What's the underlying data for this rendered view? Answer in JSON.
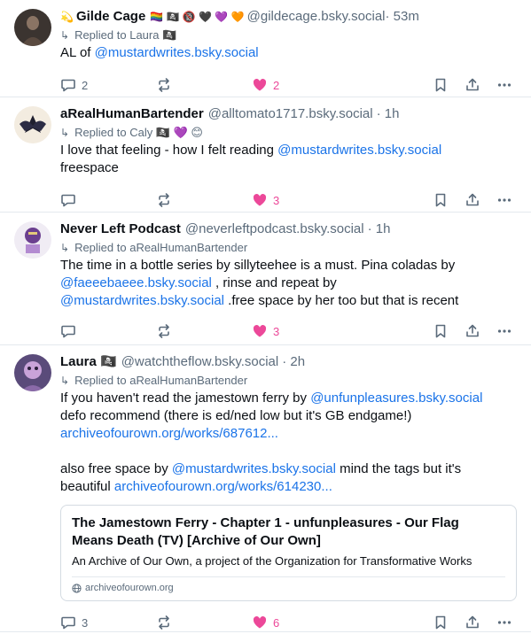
{
  "posts": [
    {
      "name": "Gilde Cage",
      "name_prefix_emoji": "💫",
      "name_suffix_emoji": "🏳️‍🌈 🏴‍☠️ 🔞 🖤 💜 🧡",
      "handle": "@gildecage.bsky.social",
      "time": "· 53m",
      "reply_to": "Replied to Laura 🏴‍☠️",
      "body": [
        {
          "text": "AL of ",
          "link": "@mustardwrites.bsky.social"
        }
      ],
      "replies": "2",
      "likes": "2"
    },
    {
      "name": "aRealHumanBartender",
      "handle": "@alltomato1717.bsky.social",
      "time": "· 1h",
      "reply_to": "Replied to Caly 🏴‍☠️ 💜 😊",
      "body_line1_text": "I love that feeling - how I felt reading ",
      "body_line1_link": "@mustardwrites.bsky.social",
      "body_line2": "freespace",
      "replies": "",
      "likes": "3"
    },
    {
      "name": "Never Left Podcast",
      "handle": "@neverleftpodcast.bsky.social",
      "time": "· 1h",
      "reply_to": "Replied to aRealHumanBartender",
      "line1": "The time in a bottle series by sillyteehee is a must. Pina coladas by",
      "line2_link": "@faeeebaeee.bsky.social",
      "line2_text": " , rinse and repeat  by",
      "line3_link": "@mustardwrites.bsky.social",
      "line3_text": " .free space by her too but that is recent",
      "replies": "",
      "likes": "3"
    },
    {
      "name": "Laura 🏴‍☠️",
      "handle": "@watchtheflow.bsky.social",
      "time": "· 2h",
      "reply_to": "Replied to aRealHumanBartender",
      "line1_text": "If you haven't read the jamestown ferry by ",
      "line1_link": "@unfunpleasures.bsky.social",
      "line2": "defo recommend (there is ed/ned low but it's GB endgame!)",
      "line3_link": "archiveofourown.org/works/687612...",
      "line4_text": "also free space by ",
      "line4_link": "@mustardwrites.bsky.social",
      "line4_tail": " mind the tags but it's",
      "line5_text": "beautiful ",
      "line5_link": "archiveofourown.org/works/614230...",
      "card": {
        "title_line1": "The Jamestown Ferry - Chapter 1 - unfunpleasures - Our Flag",
        "title_line2": "Means Death (TV) [Archive of Our Own]",
        "description": "An Archive of Our Own, a project of the Organization for Transformative Works",
        "domain": "archiveofourown.org"
      },
      "replies": "3",
      "likes": "6"
    }
  ],
  "colors": {
    "like": "#ec4899",
    "link": "#1a73e8",
    "muted": "#5b6b7b"
  },
  "icons": [
    "reply-icon",
    "repost-icon",
    "heart-icon",
    "bookmark-icon",
    "share-icon",
    "more-icon"
  ]
}
